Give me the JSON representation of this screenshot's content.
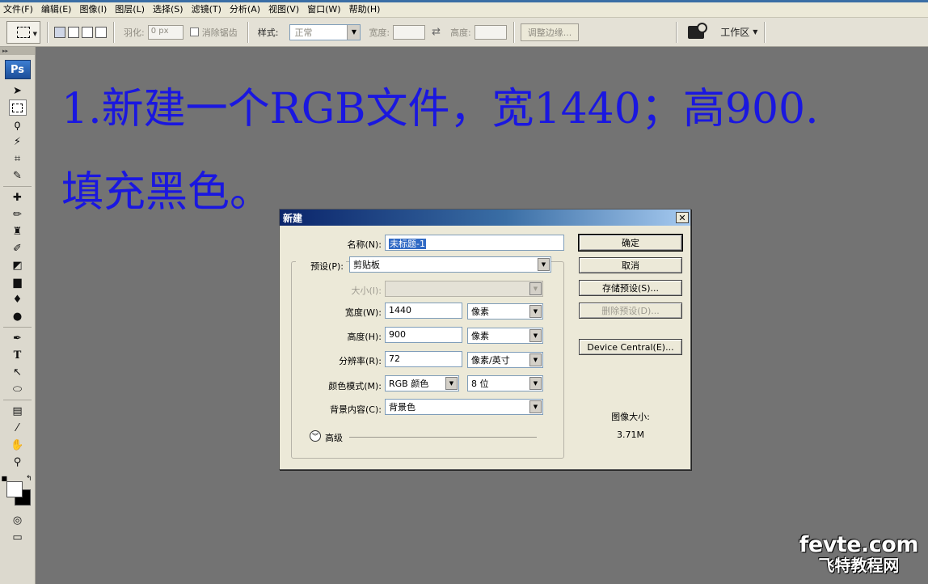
{
  "menu": [
    "文件(F)",
    "编辑(E)",
    "图像(I)",
    "图层(L)",
    "选择(S)",
    "滤镜(T)",
    "分析(A)",
    "视图(V)",
    "窗口(W)",
    "帮助(H)"
  ],
  "options": {
    "feather_label": "羽化:",
    "feather_value": "0 px",
    "antialias_label": "消除锯齿",
    "style_label": "样式:",
    "style_value": "正常",
    "width_label": "宽度:",
    "height_label": "高度:",
    "refine_label": "调整边缘...",
    "workspace_label": "工作区"
  },
  "toolbox": {
    "logo": "Ps"
  },
  "instructions": {
    "line1": "1.新建一个RGB文件，宽1440；高900.",
    "line2": "填充黑色。"
  },
  "dialog": {
    "title": "新建",
    "name_label": "名称(N):",
    "name_value": "未标题-1",
    "preset_label": "预设(P):",
    "preset_value": "剪贴板",
    "size_label": "大小(I):",
    "width_label": "宽度(W):",
    "width_value": "1440",
    "width_unit": "像素",
    "height_label": "高度(H):",
    "height_value": "900",
    "height_unit": "像素",
    "resolution_label": "分辨率(R):",
    "resolution_value": "72",
    "resolution_unit": "像素/英寸",
    "color_mode_label": "颜色模式(M):",
    "color_mode_value": "RGB 颜色",
    "bit_depth_value": "8 位",
    "background_label": "背景内容(C):",
    "background_value": "背景色",
    "advanced_label": "高级",
    "buttons": {
      "ok": "确定",
      "cancel": "取消",
      "save_preset": "存储预设(S)...",
      "delete_preset": "删除预设(D)...",
      "device_central": "Device Central(E)..."
    },
    "image_size_label": "图像大小:",
    "image_size_value": "3.71M"
  },
  "watermark": {
    "top": "fevte.com",
    "bottom": "飞特教程网"
  },
  "colors": {
    "instruction_text": "#1a17e0",
    "title_bar": "#0a246a"
  }
}
